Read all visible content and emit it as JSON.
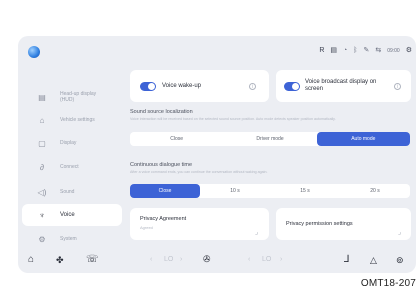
{
  "status_bar": {
    "icons": [
      "R",
      "▤",
      "◔",
      "ᛒ",
      "✎",
      "⇆"
    ],
    "clock": "09:00"
  },
  "sidebar": {
    "items": [
      {
        "label": "Head-up display (HUD)",
        "icon": "hud-icon",
        "glyph": "▤"
      },
      {
        "label": "Vehicle settings",
        "icon": "car-icon",
        "glyph": "⌂"
      },
      {
        "label": "Display",
        "icon": "display-icon",
        "glyph": "▢"
      },
      {
        "label": "Connect",
        "icon": "link-icon",
        "glyph": "∂"
      },
      {
        "label": "Sound",
        "icon": "speaker-icon",
        "glyph": "◁)"
      },
      {
        "label": "Voice",
        "icon": "microphone-icon",
        "glyph": "♆"
      },
      {
        "label": "System",
        "icon": "system-gear-icon",
        "glyph": "⚙"
      }
    ],
    "active_index": 5
  },
  "main": {
    "voice_wakeup": {
      "label": "Voice wake-up",
      "on": true
    },
    "voice_broadcast": {
      "label": "Voice broadcast display on screen",
      "on": true
    },
    "sound_source": {
      "title": "Sound source localization",
      "description": "Voice interaction will be received based on the selected sound source position. Auto mode detects speaker position automatically.",
      "options": [
        "Close",
        "Driver mode",
        "Auto mode"
      ],
      "selected": "Auto mode"
    },
    "dialogue_time": {
      "title": "Continuous dialogue time",
      "description": "After a voice command ends, you can continue the conversation without waking again.",
      "options": [
        "Close",
        "10 s",
        "15 s",
        "20 s"
      ],
      "selected": "Close"
    },
    "privacy_agreement": {
      "title": "Privacy Agreement",
      "subtitle": "Agreed"
    },
    "privacy_permission": {
      "title": "Privacy permission settings"
    }
  },
  "bottom_bar": {
    "left_temp": "LO",
    "right_temp": "LO"
  },
  "figure_code": "OMT18-207"
}
